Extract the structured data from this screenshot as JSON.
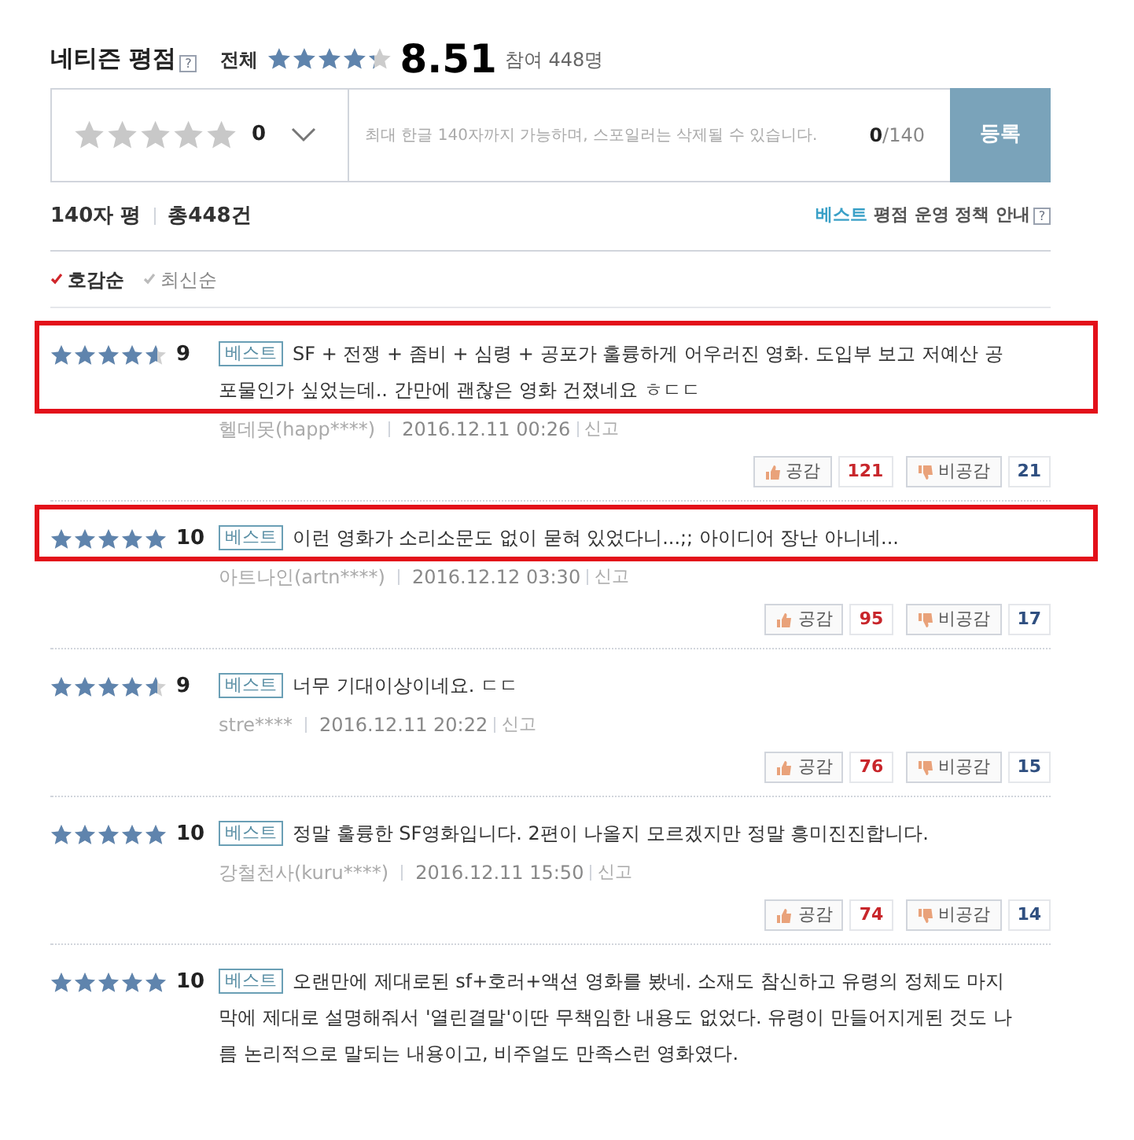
{
  "header": {
    "title": "네티즌 평점",
    "help": "?",
    "scope": "전체",
    "stars": 4.25,
    "score": "8.51",
    "participants": "참여 448명"
  },
  "composer": {
    "stars": 0,
    "score": "0",
    "placeholder": "최대 한글 140자까지 가능하며, 스포일러는 삭제될 수 있습니다.",
    "count": "0",
    "limit": "/140",
    "submit": "등록"
  },
  "summary": {
    "label": "140자 평",
    "total": "총448건",
    "policy_highlight": "베스트",
    "policy": "평점 운영 정책 안내",
    "help": "?"
  },
  "sort": [
    {
      "label": "호감순",
      "selected": true
    },
    {
      "label": "최신순",
      "selected": false
    }
  ],
  "reviews": [
    {
      "stars": 4.5,
      "score": "9",
      "badge": "베스트",
      "text": "SF + 전쟁 + 좀비 + 심령 + 공포가 훌륭하게 어우러진 영화. 도입부 보고 저예산 공포물인가 싶었는데.. 간만에 괜찮은 영화 건졌네요 ㅎㄷㄷ",
      "author": "헬데못(happ****)",
      "date": "2016.12.11 00:26",
      "report": "신고",
      "like": "공감",
      "likes": "121",
      "dislike": "비공감",
      "dislikes": "21",
      "highlighted": true
    },
    {
      "stars": 5,
      "score": "10",
      "badge": "베스트",
      "text": "이런 영화가 소리소문도 없이 묻혀 있었다니...;; 아이디어 장난 아니네...",
      "author": "아트나인(artn****)",
      "date": "2016.12.12 03:30",
      "report": "신고",
      "like": "공감",
      "likes": "95",
      "dislike": "비공감",
      "dislikes": "17",
      "highlighted": true
    },
    {
      "stars": 4.5,
      "score": "9",
      "badge": "베스트",
      "text": "너무 기대이상이네요. ㄷㄷ",
      "author": "stre****",
      "date": "2016.12.11 20:22",
      "report": "신고",
      "like": "공감",
      "likes": "76",
      "dislike": "비공감",
      "dislikes": "15",
      "highlighted": false
    },
    {
      "stars": 5,
      "score": "10",
      "badge": "베스트",
      "text": "정말 훌륭한 SF영화입니다. 2편이 나올지 모르겠지만 정말 흥미진진합니다.",
      "author": "강철천사(kuru****)",
      "date": "2016.12.11 15:50",
      "report": "신고",
      "like": "공감",
      "likes": "74",
      "dislike": "비공감",
      "dislikes": "14",
      "highlighted": false
    },
    {
      "stars": 5,
      "score": "10",
      "badge": "베스트",
      "text": "오랜만에 제대로된 sf+호러+액션 영화를 봤네. 소재도 참신하고 유령의 정체도 마지막에 제대로 설명해줘서 '열린결말'이딴 무책임한 내용도 없었다. 유령이 만들어지게된 것도 나름 논리적으로 말되는 내용이고, 비주얼도 만족스런 영화였다.",
      "highlighted": false
    }
  ]
}
